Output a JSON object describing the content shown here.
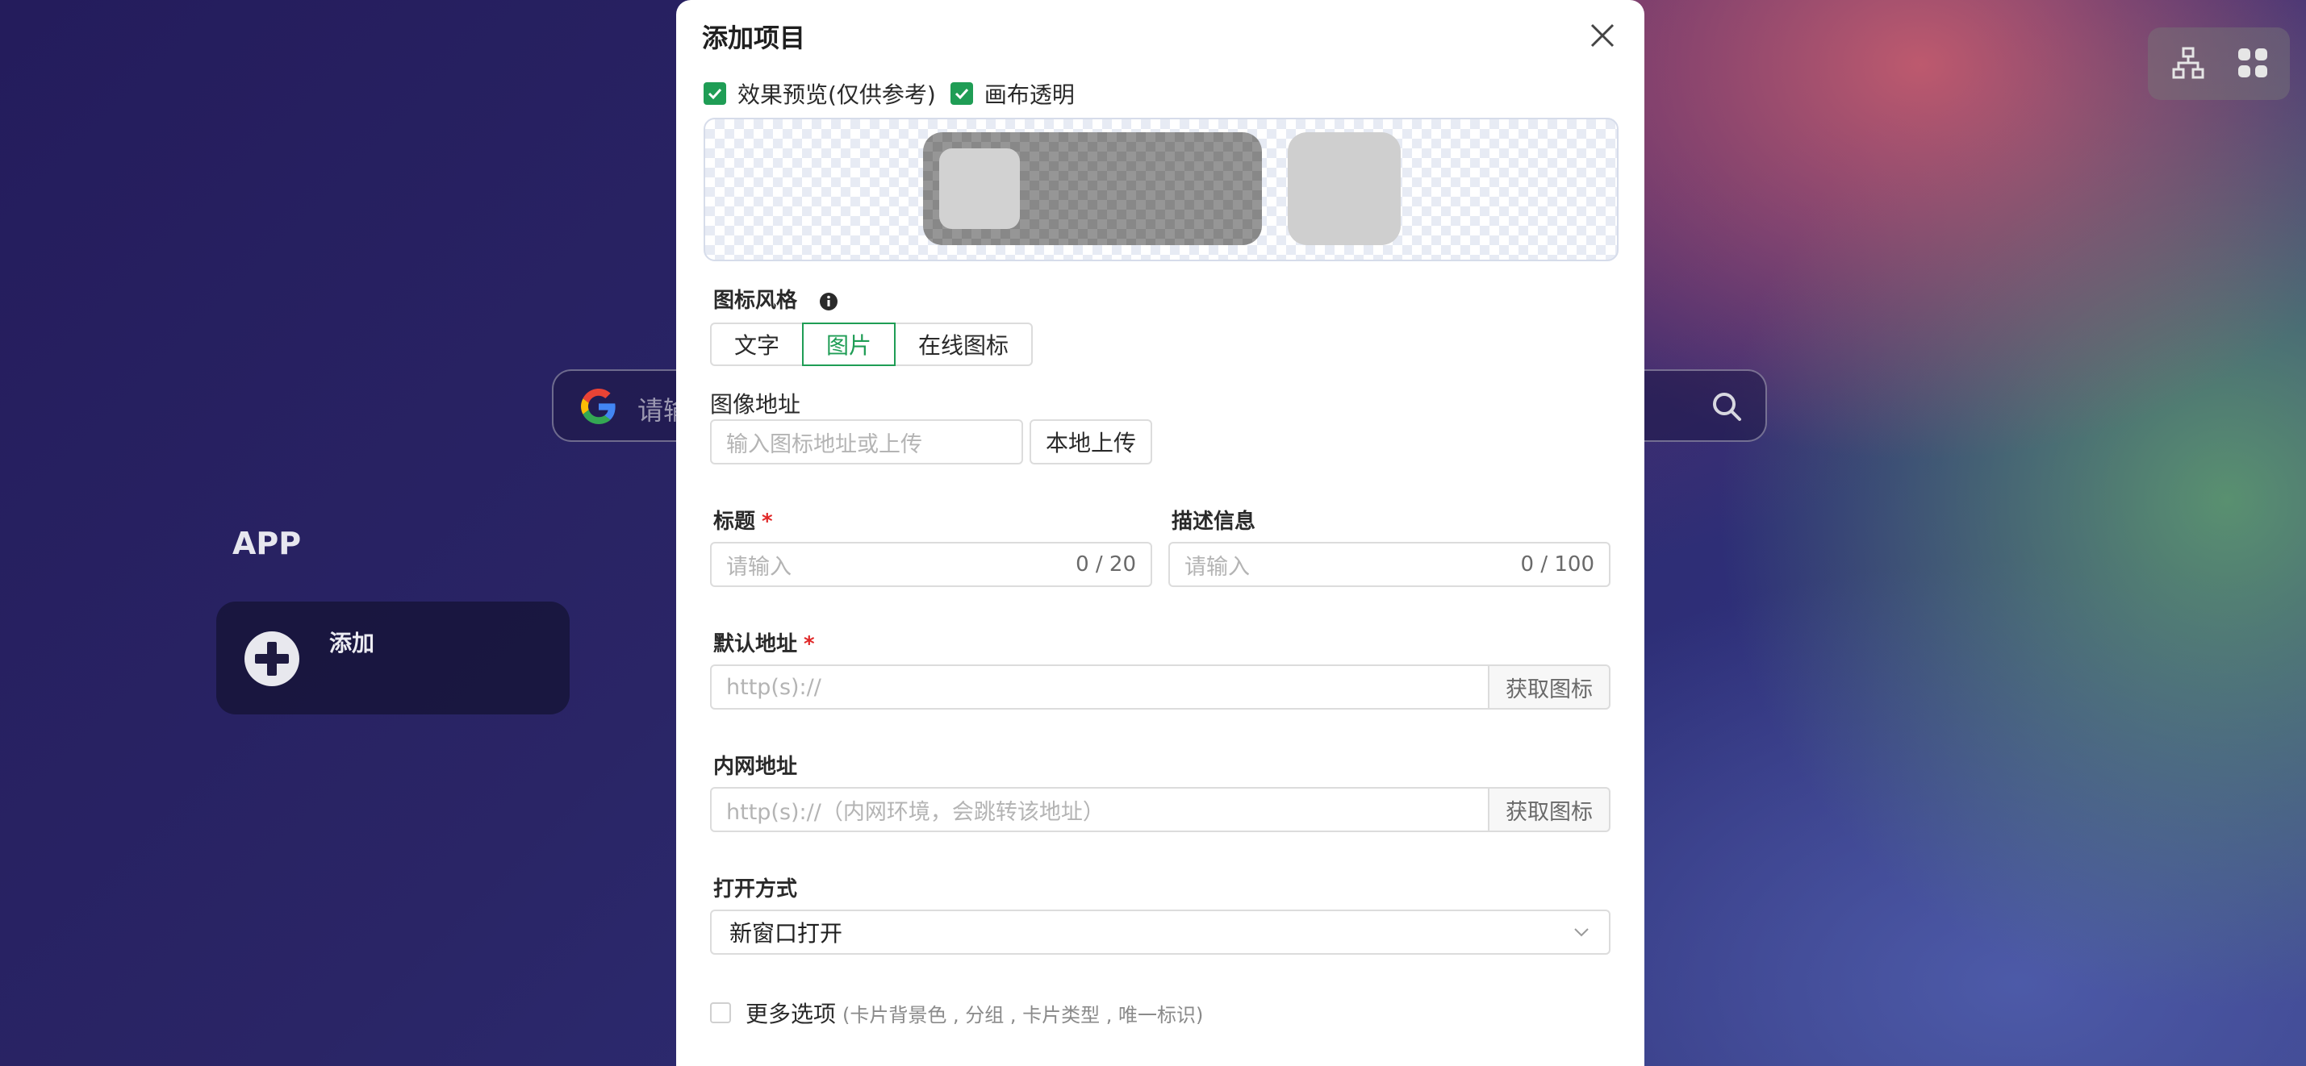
{
  "background": {
    "search": {
      "placeholder": "请输"
    },
    "app_section": {
      "title": "APP",
      "add_label": "添加"
    },
    "tools": {
      "left_icon": "sitemap-icon",
      "right_icon": "grid-icon"
    }
  },
  "modal": {
    "title": "添加项目",
    "checks": [
      {
        "label": "效果预览(仅供参考)",
        "checked": true
      },
      {
        "label": "画布透明",
        "checked": true
      }
    ],
    "icon_style": {
      "label": "图标风格",
      "options": [
        "文字",
        "图片",
        "在线图标"
      ],
      "selected": "图片"
    },
    "image_url": {
      "label": "图像地址",
      "placeholder": "输入图标地址或上传",
      "upload_label": "本地上传"
    },
    "title_field": {
      "label": "标题",
      "required": "*",
      "placeholder": "请输入",
      "count": "0 / 20"
    },
    "desc_field": {
      "label": "描述信息",
      "placeholder": "请输入",
      "count": "0 / 100"
    },
    "default_url": {
      "label": "默认地址",
      "required": "*",
      "placeholder": "http(s)://",
      "fetch_label": "获取图标"
    },
    "intranet_url": {
      "label": "内网地址",
      "placeholder": "http(s)://（内网环境，会跳转该地址）",
      "fetch_label": "获取图标"
    },
    "open_mode": {
      "label": "打开方式",
      "value": "新窗口打开"
    },
    "more_options": {
      "label": "更多选项",
      "hint": "(卡片背景色 , 分组 , 卡片类型 , 唯一标识)",
      "checked": false
    }
  },
  "colors": {
    "accent": "#1f9d55",
    "required": "#e02828"
  }
}
